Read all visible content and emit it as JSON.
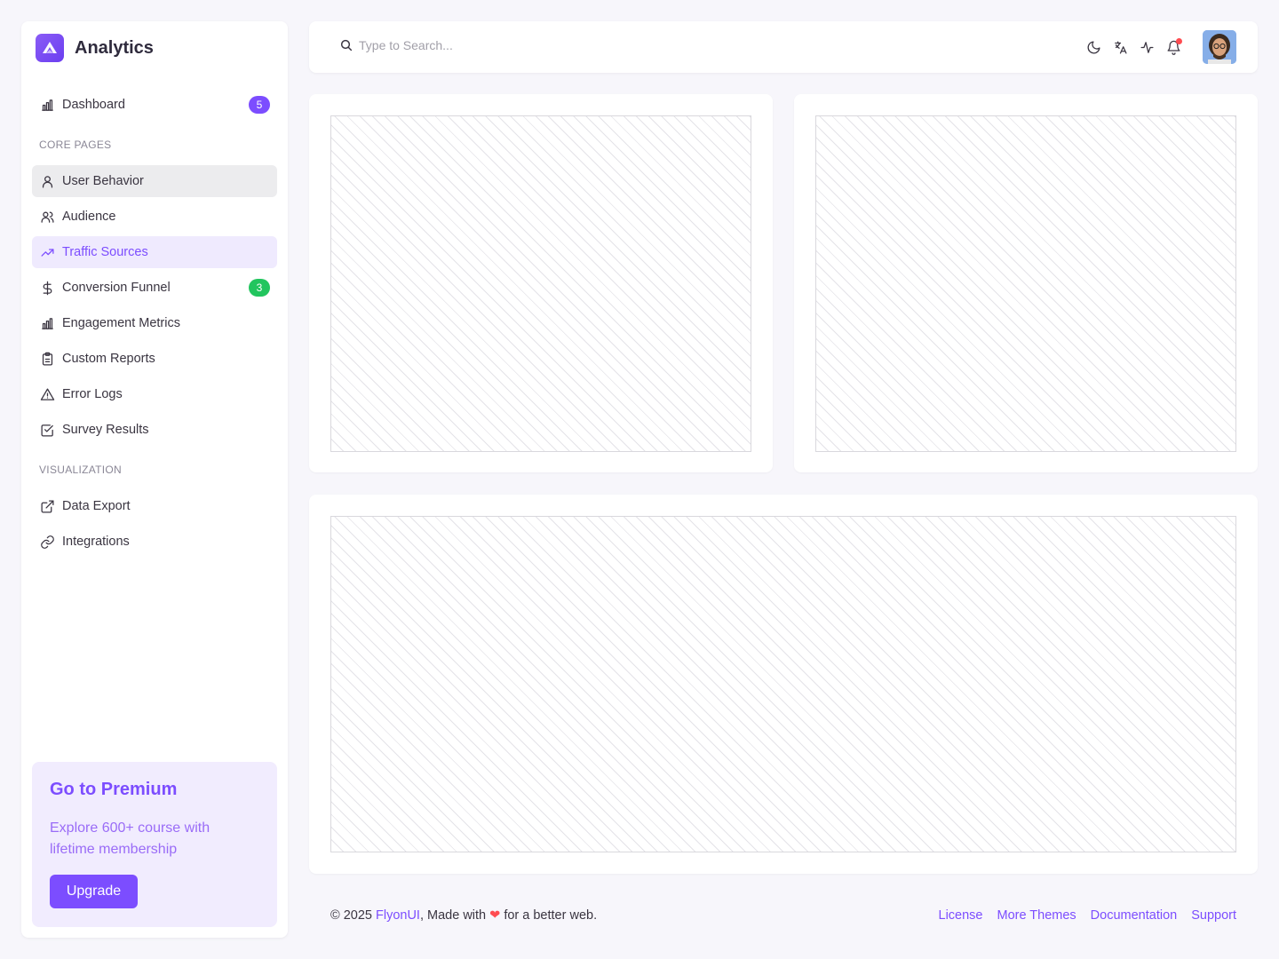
{
  "app": {
    "title": "Analytics"
  },
  "sidebar": {
    "items_top": [
      {
        "label": "Dashboard",
        "icon": "bar-chart-icon",
        "badge": "5"
      }
    ],
    "section_core": "CORE PAGES",
    "core_items": [
      {
        "label": "User Behavior",
        "icon": "user-icon"
      },
      {
        "label": "Audience",
        "icon": "users-icon"
      },
      {
        "label": "Traffic Sources",
        "icon": "trending-up-icon"
      },
      {
        "label": "Conversion Funnel",
        "icon": "dollar-icon",
        "badge": "3"
      },
      {
        "label": "Engagement Metrics",
        "icon": "bar-chart-icon"
      },
      {
        "label": "Custom Reports",
        "icon": "clipboard-icon"
      },
      {
        "label": "Error Logs",
        "icon": "alert-triangle-icon"
      },
      {
        "label": "Survey Results",
        "icon": "checkbox-icon"
      }
    ],
    "section_visual": "VISUALIZATION",
    "visual_items": [
      {
        "label": "Data Export",
        "icon": "external-link-icon"
      },
      {
        "label": "Integrations",
        "icon": "link-icon"
      }
    ],
    "premium": {
      "title": "Go to Premium",
      "text": "Explore 600+ course with lifetime membership",
      "button": "Upgrade"
    }
  },
  "topbar": {
    "search_placeholder": "Type to Search...",
    "icons": [
      "moon-icon",
      "translate-icon",
      "activity-icon",
      "bell-icon"
    ]
  },
  "footer": {
    "copyright": "© 2025 ",
    "brand": "FlyonUI",
    "made_with": ", Made with ",
    "heart": "❤",
    "tail": " for a better web.",
    "links": [
      "License",
      "More Themes",
      "Documentation",
      "Support"
    ]
  },
  "colors": {
    "accent": "#7c4dff",
    "success": "#22c55e",
    "danger": "#ff4c51"
  }
}
